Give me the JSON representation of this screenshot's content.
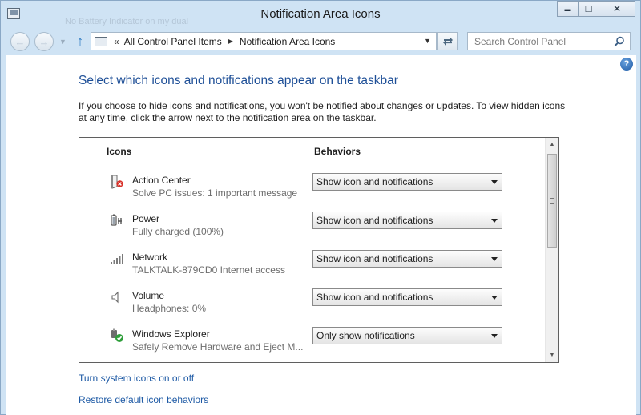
{
  "window": {
    "title": "Notification Area Icons",
    "ghost_title": "No Battery Indicator on my dual",
    "buttons": {
      "minimize": "▬",
      "maximize": "□",
      "close": "✕"
    }
  },
  "nav": {
    "back_glyph": "←",
    "forward_glyph": "→",
    "up_glyph": "↑",
    "address": {
      "prefix": "«",
      "breadcrumbs": [
        "All Control Panel Items",
        "Notification Area Icons"
      ]
    },
    "search": {
      "placeholder": "Search Control Panel",
      "value": ""
    }
  },
  "main": {
    "help_label": "?",
    "heading": "Select which icons and notifications appear on the taskbar",
    "description": "If you choose to hide icons and notifications, you won't be notified about changes or updates. To view hidden icons at any time, click the arrow next to the notification area on the taskbar.",
    "columns": {
      "icons": "Icons",
      "behaviors": "Behaviors"
    },
    "rows": [
      {
        "icon": "action-center-icon",
        "name": "Action Center",
        "subtitle": "Solve PC issues: 1 important message",
        "behavior": "Show icon and notifications"
      },
      {
        "icon": "power-icon",
        "name": "Power",
        "subtitle": "Fully charged (100%)",
        "behavior": "Show icon and notifications"
      },
      {
        "icon": "network-icon",
        "name": "Network",
        "subtitle": "TALKTALK-879CD0 Internet access",
        "behavior": "Show icon and notifications"
      },
      {
        "icon": "volume-icon",
        "name": "Volume",
        "subtitle": "Headphones: 0%",
        "behavior": "Show icon and notifications"
      },
      {
        "icon": "windows-explorer-icon",
        "name": "Windows Explorer",
        "subtitle": "Safely Remove Hardware and Eject M...",
        "behavior": "Only show notifications"
      }
    ],
    "links": {
      "system_icons": "Turn system icons on or off",
      "restore": "Restore default icon behaviors"
    }
  },
  "colors": {
    "heading": "#1e4f97",
    "link": "#1e5aa5",
    "frame": "#cfe3f4"
  }
}
